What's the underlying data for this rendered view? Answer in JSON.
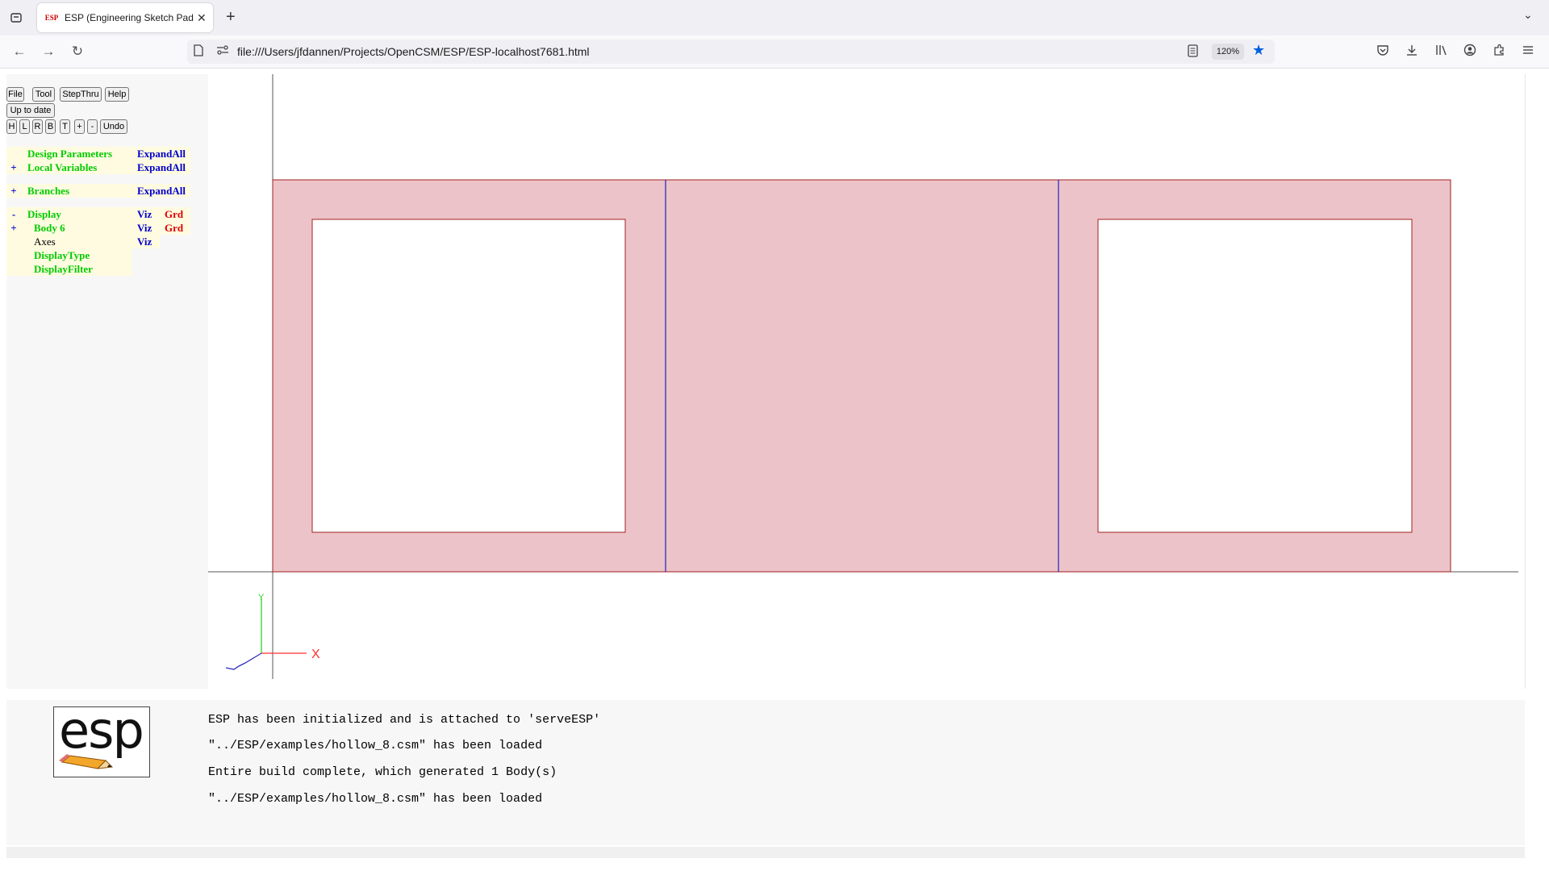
{
  "browser": {
    "tab_title": "ESP (Engineering Sketch Pad, V",
    "tab_favicon": "ESP",
    "url": "file:///Users/jfdannen/Projects/OpenCSM/ESP/ESP-localhost7681.html",
    "zoom": "120%",
    "icons": {
      "tab_list": "tab-list-icon",
      "close": "close-icon",
      "new_tab": "plus-icon",
      "overflow": "chevron-down-icon",
      "back": "back-arrow-icon",
      "forward": "forward-arrow-icon",
      "reload": "reload-icon",
      "page": "page-icon",
      "permissions": "permissions-icon",
      "reader": "reader-view-icon",
      "bookmark": "star-icon",
      "pocket": "pocket-icon",
      "downloads": "download-icon",
      "library": "library-icon",
      "account": "account-icon",
      "extensions": "extensions-icon",
      "menu": "hamburger-menu-icon"
    },
    "bookmark_color": "#0060df"
  },
  "toolbar": {
    "file": "File",
    "tool": "Tool",
    "stepthru": "StepThru",
    "help": "Help",
    "status": "Up to date",
    "view_buttons": [
      "H",
      "L",
      "R",
      "B",
      "T",
      "+",
      "-"
    ],
    "undo": "Undo"
  },
  "tree": {
    "design_parameters": {
      "pm": "",
      "label": "Design Parameters",
      "action": "ExpandAll"
    },
    "local_variables": {
      "pm": "+",
      "label": "Local Variables",
      "action": "ExpandAll"
    },
    "branches": {
      "pm": "+",
      "label": "Branches",
      "action": "ExpandAll"
    },
    "display": {
      "pm": "-",
      "label": "Display",
      "viz": "Viz",
      "grd": "Grd"
    },
    "body6": {
      "pm": "+",
      "label": "Body 6",
      "viz": "Viz",
      "grd": "Grd"
    },
    "axes": {
      "pm": "",
      "label": "Axes",
      "viz": "Viz"
    },
    "display_type": {
      "label": "DisplayType"
    },
    "display_filter": {
      "label": "DisplayFilter"
    }
  },
  "graphics": {
    "axes_labels": {
      "x": "X",
      "y": "Y"
    },
    "colors": {
      "face_fill": "#ecc3c8",
      "face_edge": "#a02020",
      "inner_edge": "#2020c0",
      "axis_line": "#555555",
      "x_axis": "#ff3030",
      "y_axis": "#30d030",
      "z_axis": "#3030c0"
    }
  },
  "logo": {
    "text": "esp"
  },
  "messages": [
    "ESP has been initialized and is attached to 'serveESP'",
    "\"../ESP/examples/hollow_8.csm\" has been loaded",
    "Entire build complete, which generated 1 Body(s)",
    "\"../ESP/examples/hollow_8.csm\" has been loaded"
  ]
}
